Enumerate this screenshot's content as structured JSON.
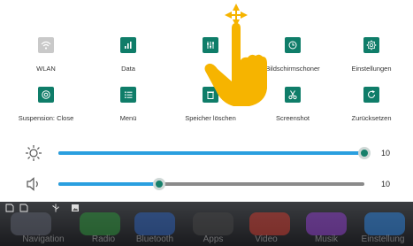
{
  "tiles": [
    {
      "label": "WLAN",
      "icon": "wifi-icon"
    },
    {
      "label": "Data",
      "icon": "signal-bars-icon"
    },
    {
      "label": "",
      "icon": "equalizer-icon"
    },
    {
      "label": "Bildschirmschoner",
      "icon": "screensaver-clock-icon"
    },
    {
      "label": "Einstellungen",
      "icon": "gear-icon"
    },
    {
      "label": "Suspension: Close",
      "icon": "suspension-icon"
    },
    {
      "label": "Menü",
      "icon": "menu-list-icon"
    },
    {
      "label": "Speicher löschen",
      "icon": "clear-memory-icon"
    },
    {
      "label": "Screenshot",
      "icon": "scissors-icon"
    },
    {
      "label": "Zurücksetzen",
      "icon": "reset-icon"
    }
  ],
  "sliders": {
    "brightness": {
      "value": "10",
      "level": 1.0,
      "icon": "sun-icon"
    },
    "volume": {
      "value": "10",
      "level": 0.33,
      "icon": "speaker-icon"
    }
  },
  "dock": {
    "items": [
      "Navigation",
      "Radio",
      "Bluetooth",
      "Apps",
      "Video",
      "Musik",
      "Einstellung"
    ]
  },
  "colors": {
    "tile_accent": "#0f7d69",
    "slider_fill": "#2a9fdf",
    "gesture_hand": "#f6b400"
  }
}
